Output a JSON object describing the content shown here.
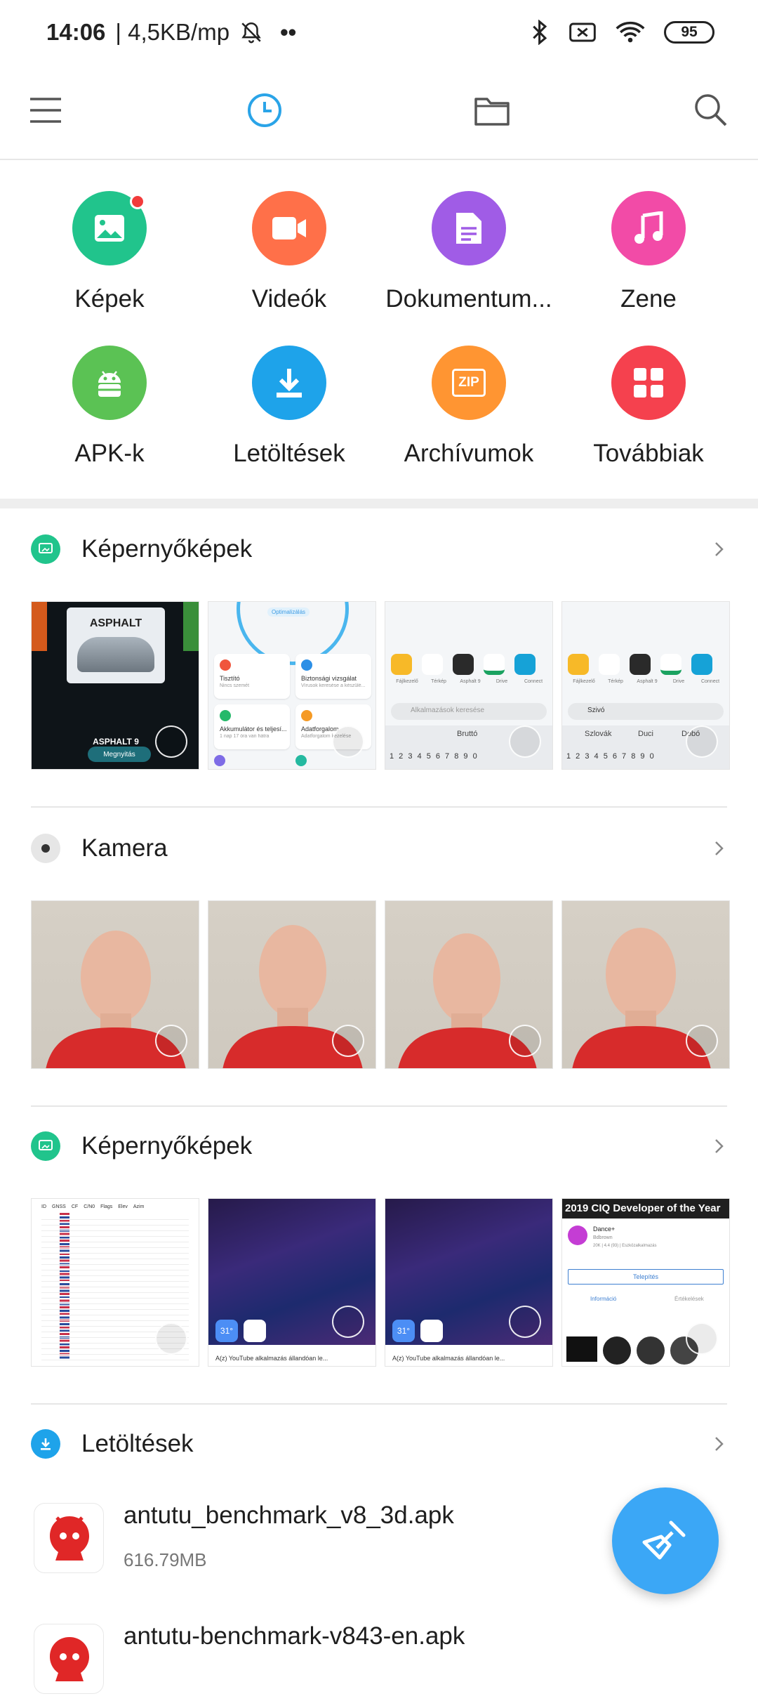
{
  "status": {
    "time": "14:06",
    "speed": "| 4,5KB/mp",
    "dots": "••",
    "battery": "95"
  },
  "nav": {
    "menu_icon": "menu-icon",
    "recent_icon": "clock-icon",
    "folder_icon": "folder-icon",
    "search_icon": "search-icon",
    "accent": "#2aa4e8"
  },
  "categories": [
    {
      "label": "Képek",
      "color": "#21c48c",
      "icon": "image-icon"
    },
    {
      "label": "Videók",
      "color": "#ff7049",
      "icon": "video-icon"
    },
    {
      "label": "Dokumentum...",
      "color": "#a05ce6",
      "icon": "document-icon"
    },
    {
      "label": "Zene",
      "color": "#f24ba7",
      "icon": "music-icon"
    },
    {
      "label": "APK-k",
      "color": "#5bc254",
      "icon": "android-icon"
    },
    {
      "label": "Letöltések",
      "color": "#1ea3ea",
      "icon": "download-icon"
    },
    {
      "label": "Archívumok",
      "color": "#ff9532",
      "icon": "zip-icon"
    },
    {
      "label": "Továbbiak",
      "color": "#f5414e",
      "icon": "more-icon"
    }
  ],
  "zip_text": "ZIP",
  "sections": {
    "screens1": {
      "title": "Képernyőképek",
      "t1_logo": "ASPHALT",
      "t1_caption": "ASPHALT 9",
      "t1_button": "Megnyitás",
      "t2_badge": "Optimalizálás",
      "t2_items": [
        {
          "title": "Tisztító",
          "sub": "Nincs szemét"
        },
        {
          "title": "Biztonsági vizsgálat",
          "sub": "Vírusok keresése a készülé..."
        },
        {
          "title": "Akkumulátor és teljesí...",
          "sub": "1 nap 17 óra  van hátra"
        },
        {
          "title": "Adatforgalom",
          "sub": "Adatforgalom kezelése"
        }
      ],
      "t3_search": "Alkalmazások keresése",
      "t3_apps": [
        "Fájlkezelő",
        "Térkép",
        "Asphalt 9",
        "Drive",
        "Connect"
      ],
      "t3_suggest": "Bruttó",
      "t4_search": "Szivó",
      "t4_suggest": [
        "Szlovák",
        "Duci",
        "Dobó"
      ],
      "digits": "1 2 3 4 5 6 7 8 9 0"
    },
    "camera": {
      "title": "Kamera"
    },
    "screens2": {
      "title": "Képernyőképek",
      "gnss_header": [
        "ID",
        "GNSS",
        "CF",
        "C/N0",
        "Flags",
        "Elev",
        "Azim"
      ],
      "wall_caption": "A(z) YouTube alkalmazás állandóan le...",
      "wall_temp": "31°",
      "ciq_title": "2019 CIQ Developer of the Year",
      "ciq_app": "Dance+",
      "ciq_author": "Bdbrown",
      "ciq_meta": "20K | 4.4 (93) | Eszközalkalmazás",
      "ciq_install": "Telepítés",
      "ciq_tab1": "Információ",
      "ciq_tab2": "Értékelések"
    },
    "downloads": {
      "title": "Letöltések",
      "files": [
        {
          "name": "antutu_benchmark_v8_3d.apk",
          "size": "616.79MB"
        },
        {
          "name": "antutu-benchmark-v843-en.apk",
          "size": ""
        }
      ]
    }
  },
  "fab_icon": "broom-icon"
}
